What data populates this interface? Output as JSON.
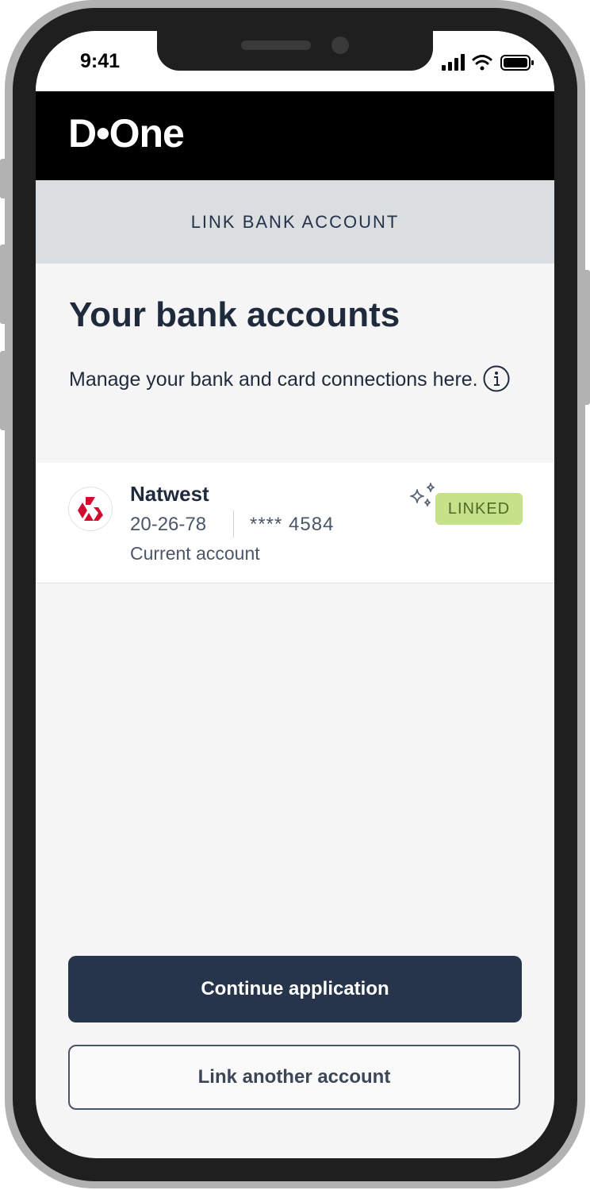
{
  "status_bar": {
    "time": "9:41"
  },
  "brand": {
    "logo_text": "D•One"
  },
  "subheader": {
    "title": "LINK BANK ACCOUNT"
  },
  "intro": {
    "title": "Your bank accounts",
    "description": "Manage your bank and card connections here."
  },
  "accounts": [
    {
      "bank_name": "Natwest",
      "sort_code": "20-26-78",
      "account_number": "**** 4584",
      "account_type": "Current account",
      "status": "LINKED",
      "logo_color": "#d20a2e"
    }
  ],
  "actions": {
    "primary_label": "Continue application",
    "secondary_label": "Link another account"
  },
  "colors": {
    "primary": "#26354b",
    "linked_badge": "#c6e18a",
    "header_bg": "#000000"
  },
  "icons": [
    "signal-icon",
    "wifi-icon",
    "battery-icon",
    "info-icon",
    "natwest-logo-icon",
    "sparkle-icon"
  ]
}
